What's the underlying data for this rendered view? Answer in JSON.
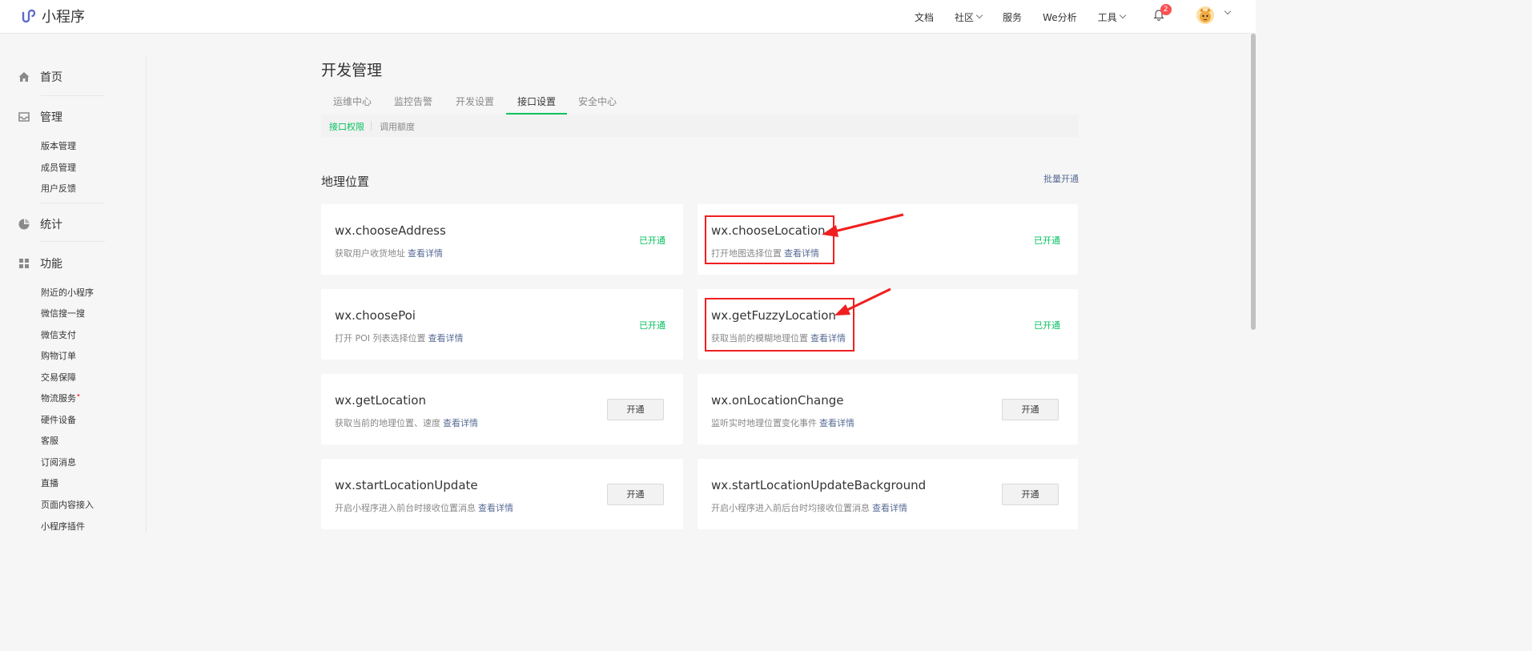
{
  "app": {
    "title": "小程序"
  },
  "topnav": {
    "items": [
      {
        "label": "文档",
        "has_caret": false
      },
      {
        "label": "社区",
        "has_caret": true
      },
      {
        "label": "服务",
        "has_caret": false
      },
      {
        "label": "We分析",
        "has_caret": false
      },
      {
        "label": "工具",
        "has_caret": true
      }
    ],
    "notification_count": "2"
  },
  "sidebar": {
    "home": "首页",
    "manage": "管理",
    "manage_items": [
      "版本管理",
      "成员管理",
      "用户反馈"
    ],
    "stats": "统计",
    "features": "功能",
    "feature_items": [
      "附近的小程序",
      "微信搜一搜",
      "微信支付",
      "购物订单",
      "交易保障",
      "物流服务",
      "硬件设备",
      "客服",
      "订阅消息",
      "直播",
      "页面内容接入",
      "小程序插件"
    ]
  },
  "page": {
    "title": "开发管理",
    "tabs": [
      "运维中心",
      "监控告警",
      "开发设置",
      "接口设置",
      "安全中心"
    ],
    "subtabs": [
      "接口权限",
      "调用额度"
    ],
    "section_title": "地理位置",
    "batch_open": "批量开通"
  },
  "apis": [
    {
      "name": "wx.chooseAddress",
      "desc": "获取用户收货地址",
      "link": "查看详情",
      "status": "已开通"
    },
    {
      "name": "wx.chooseLocation",
      "desc": "打开地图选择位置",
      "link": "查看详情",
      "status": "已开通"
    },
    {
      "name": "wx.choosePoi",
      "desc": "打开 POI 列表选择位置",
      "link": "查看详情",
      "status": "已开通"
    },
    {
      "name": "wx.getFuzzyLocation",
      "desc": "获取当前的模糊地理位置",
      "link": "查看详情",
      "status": "已开通"
    },
    {
      "name": "wx.getLocation",
      "desc": "获取当前的地理位置、速度",
      "link": "查看详情",
      "button": "开通"
    },
    {
      "name": "wx.onLocationChange",
      "desc": "监听实时地理位置变化事件",
      "link": "查看详情",
      "button": "开通"
    },
    {
      "name": "wx.startLocationUpdate",
      "desc": "开启小程序进入前台时接收位置消息",
      "link": "查看详情",
      "button": "开通"
    },
    {
      "name": "wx.startLocationUpdateBackground",
      "desc": "开启小程序进入前后台时均接收位置消息",
      "link": "查看详情",
      "button": "开通"
    }
  ],
  "colors": {
    "accent": "#07c160",
    "link": "#576b95",
    "highlight": "#f01f1f",
    "badge": "#fa5151"
  }
}
